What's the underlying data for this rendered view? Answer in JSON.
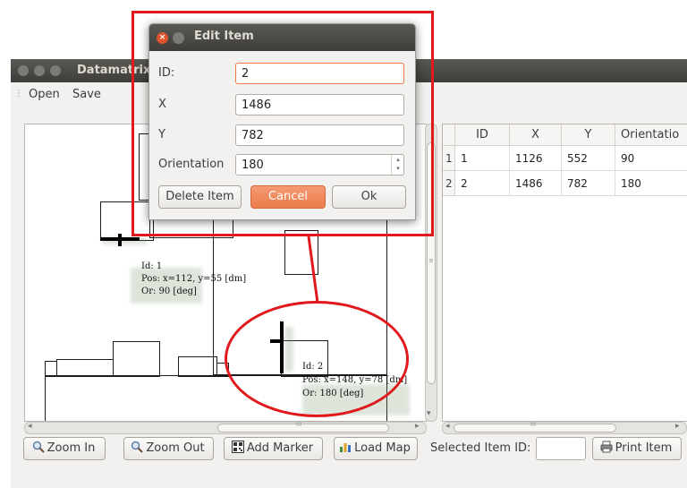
{
  "main_window": {
    "title": "Datamatrix",
    "menu": [
      "Open",
      "Save"
    ]
  },
  "map": {
    "items": [
      {
        "id_label": "Id: 1",
        "pos_label": "Pos: x=112, y=55 [dm]",
        "or_label": "Or: 90 [deg]"
      },
      {
        "id_label": "Id: 2",
        "pos_label": "Pos: x=148, y=78 [dm]",
        "or_label": "Or: 180 [deg]"
      }
    ]
  },
  "table": {
    "columns": [
      "ID",
      "X",
      "Y",
      "Orientatio"
    ],
    "rows": [
      {
        "row_header": "1",
        "id": "1",
        "x": "1126",
        "y": "552",
        "orientation": "90"
      },
      {
        "row_header": "2",
        "id": "2",
        "x": "1486",
        "y": "782",
        "orientation": "180"
      }
    ]
  },
  "toolbar": {
    "zoom_in": "Zoom In",
    "zoom_out": "Zoom Out",
    "add_marker": "Add Marker",
    "load_map": "Load Map",
    "selected_item_label": "Selected Item ID:",
    "selected_item_value": "",
    "print_item": "Print Item"
  },
  "dialog": {
    "title": "Edit Item",
    "fields": {
      "id_label": "ID:",
      "id_value": "2",
      "x_label": "X",
      "x_value": "1486",
      "y_label": "Y",
      "y_value": "782",
      "orientation_label": "Orientation",
      "orientation_value": "180"
    },
    "buttons": {
      "delete": "Delete Item",
      "cancel": "Cancel",
      "ok": "Ok"
    }
  },
  "scroll_grip": "III",
  "colors": {
    "annotation_red": "#e0191c",
    "cancel_orange": "#f08a5d",
    "titlebar_dark": "#3e3d39",
    "close_button": "#e0532f",
    "focus_border": "#f07746"
  }
}
